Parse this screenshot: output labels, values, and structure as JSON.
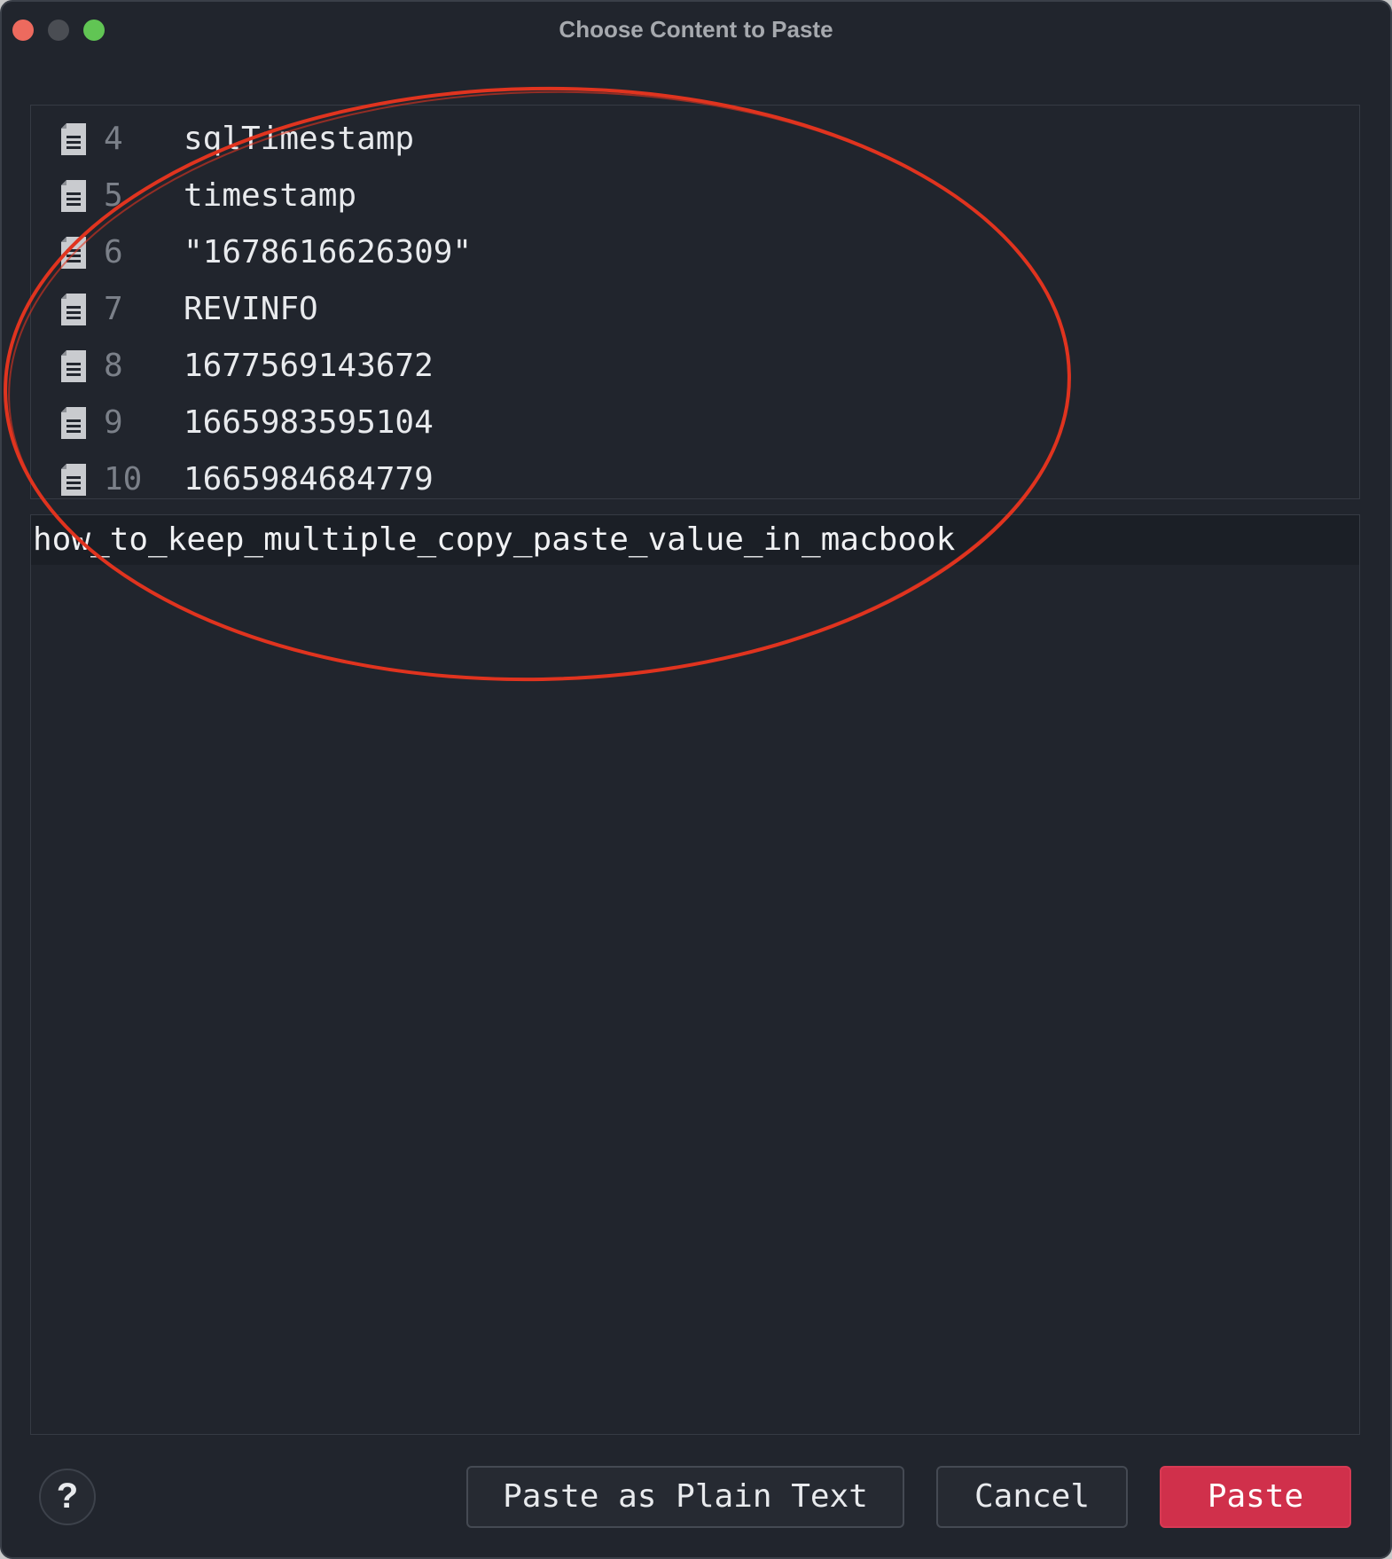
{
  "window": {
    "title": "Choose Content to Paste"
  },
  "clipboard_list": {
    "items": [
      {
        "number": "4",
        "text": "sqlTimestamp",
        "icon": "document-icon"
      },
      {
        "number": "5",
        "text": "timestamp",
        "icon": "document-icon"
      },
      {
        "number": "6",
        "text": "\"1678616626309\"",
        "icon": "document-icon"
      },
      {
        "number": "7",
        "text": "REVINFO",
        "icon": "document-icon"
      },
      {
        "number": "8",
        "text": "1677569143672",
        "icon": "document-icon"
      },
      {
        "number": "9",
        "text": "1665983595104",
        "icon": "document-icon"
      },
      {
        "number": "10",
        "text": "1665984684779",
        "icon": "document-icon"
      }
    ]
  },
  "preview": {
    "text": "how_to_keep_multiple_copy_paste_value_in_macbook"
  },
  "buttons": {
    "help": "?",
    "paste_plain": "Paste as Plain Text",
    "cancel": "Cancel",
    "paste": "Paste"
  },
  "colors": {
    "window_bg": "#21252d",
    "accent": "#d0304b",
    "annotation": "#e0341f",
    "traffic_close": "#ed6a5e",
    "traffic_max": "#61c554"
  }
}
